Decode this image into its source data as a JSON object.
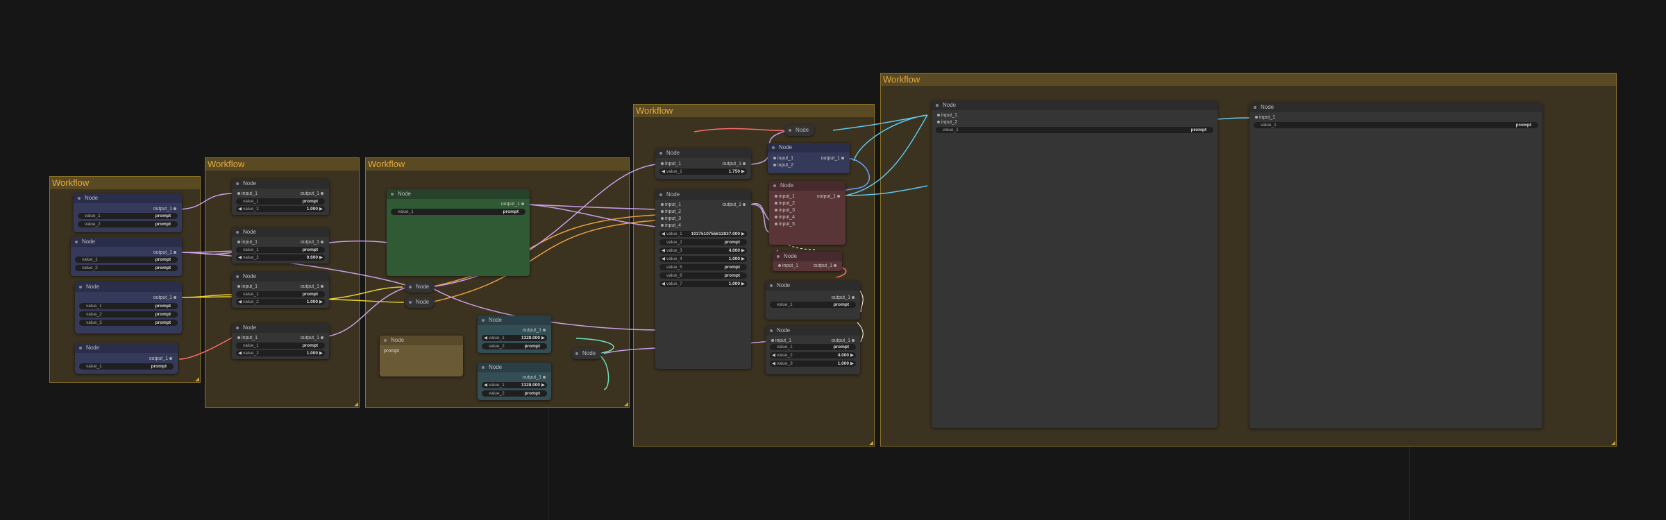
{
  "groups": [
    {
      "title": "Workflow"
    },
    {
      "title": "Workflow"
    },
    {
      "title": "Workflow"
    },
    {
      "title": "Workflow"
    },
    {
      "title": "Workflow"
    }
  ],
  "labels": {
    "node": "Node",
    "input_1": "input_1",
    "input_2": "input_2",
    "input_3": "input_3",
    "input_4": "input_4",
    "input_5": "input_5",
    "output_1": "output_1",
    "value_1": "value_1",
    "value_2": "value_2",
    "value_3": "value_3",
    "value_4": "value_4",
    "value_5": "value_5",
    "value_6": "value_6",
    "value_7": "value_7",
    "prompt": "prompt"
  },
  "values": {
    "v1000": "1.000",
    "v0600": "0.600",
    "v1750": "1.750",
    "v4000": "4.000",
    "v1328": "1328.000",
    "bigseed": "1037510755612837.000",
    "v1000b": "1.000",
    "v1000c": "1.000"
  },
  "text_note": "prompt"
}
